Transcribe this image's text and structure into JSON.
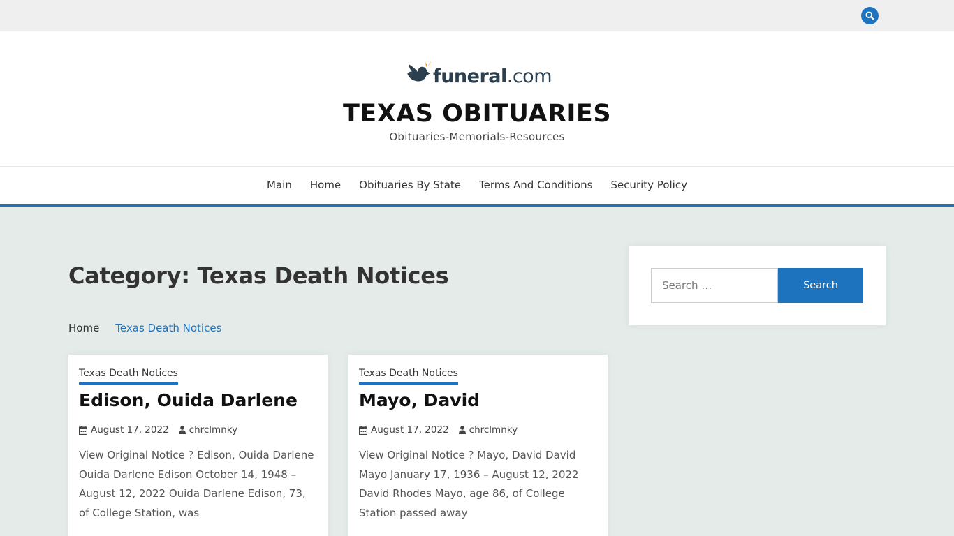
{
  "topbar": {
    "search_icon": "search-icon"
  },
  "header": {
    "logo_text_main": "funeral",
    "logo_text_suffix": ".com",
    "site_title": "TEXAS OBITUARIES",
    "tagline": "Obituaries-Memorials-Resources"
  },
  "nav": {
    "items": [
      {
        "label": "Main"
      },
      {
        "label": "Home"
      },
      {
        "label": "Obituaries By State"
      },
      {
        "label": "Terms And Conditions"
      },
      {
        "label": "Security Policy"
      }
    ]
  },
  "main": {
    "category_title": "Category: Texas Death Notices",
    "breadcrumb": {
      "home": "Home",
      "separator": "",
      "current": "Texas Death Notices"
    },
    "posts": [
      {
        "category": "Texas Death Notices",
        "title": "Edison, Ouida Darlene",
        "date": "August 17, 2022",
        "author": "chrclmnky",
        "excerpt": "View Original Notice ? Edison, Ouida Darlene Ouida Darlene Edison October 14, 1948 – August 12, 2022 Ouida Darlene Edison, 73, of College Station, was"
      },
      {
        "category": "Texas Death Notices",
        "title": "Mayo, David",
        "date": "August 17, 2022",
        "author": "chrclmnky",
        "excerpt": "View Original Notice ? Mayo, David David Mayo January 17, 1936 – August 12, 2022 David Rhodes Mayo, age 86, of College Station passed away"
      }
    ]
  },
  "sidebar": {
    "search": {
      "placeholder": "Search …",
      "button_label": "Search"
    }
  },
  "colors": {
    "accent": "#1e73be",
    "background": "#e5ebe9",
    "topbar": "#efefef"
  }
}
